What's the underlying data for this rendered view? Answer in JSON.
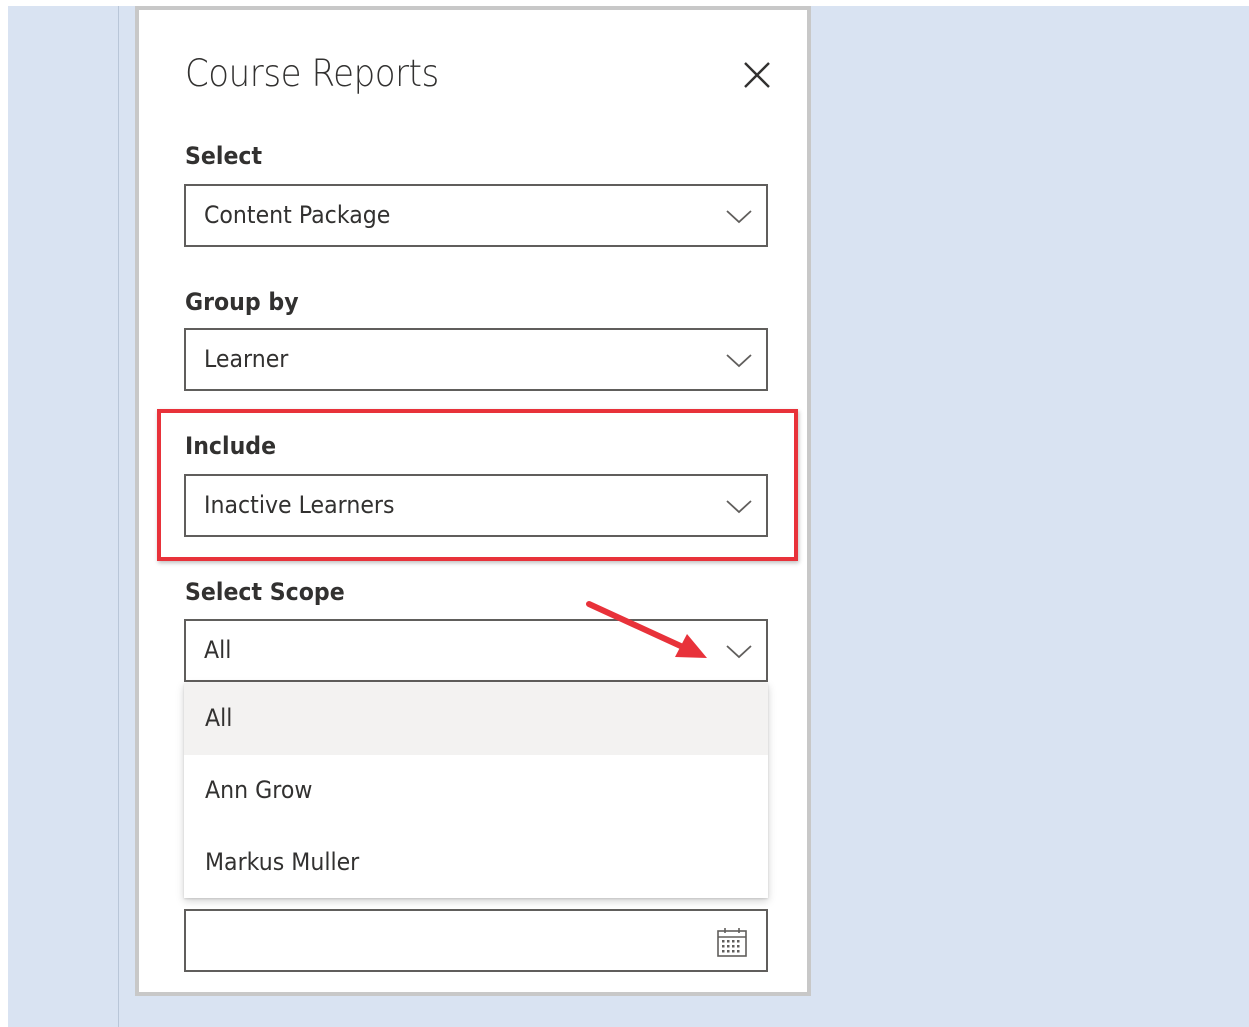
{
  "panel": {
    "title": "Course Reports",
    "fields": {
      "select": {
        "label": "Select",
        "value": "Content Package"
      },
      "group_by": {
        "label": "Group by",
        "value": "Learner"
      },
      "include": {
        "label": "Include",
        "value": "Inactive Learners"
      },
      "scope": {
        "label": "Select Scope",
        "value": "All"
      }
    },
    "scope_options": [
      "All",
      "Ann Grow",
      "Markus Muller"
    ],
    "selected_option": "All",
    "date_field": {
      "value": ""
    }
  },
  "icons": {
    "close": "close-icon",
    "chevron": "chevron-down-icon",
    "calendar": "calendar-icon"
  },
  "annotations": {
    "highlight_color": "#e8323a",
    "arrow_color": "#e8323a"
  }
}
